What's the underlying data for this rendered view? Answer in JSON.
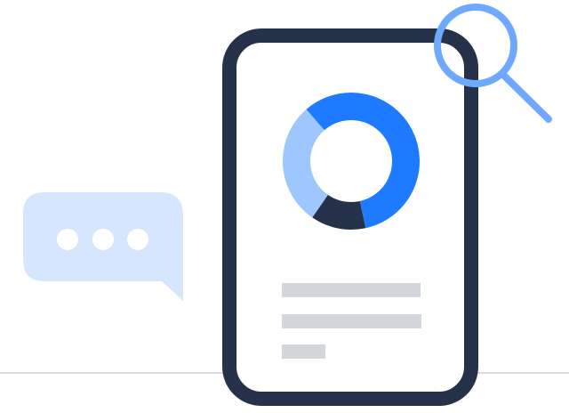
{
  "illustration": {
    "elements": {
      "chat_bubble": {
        "icon": "chat-bubble-typing-icon"
      },
      "document": {
        "icon": "mobile-document-icon"
      },
      "donut_chart": {
        "icon": "donut-chart-icon"
      },
      "text_lines": {
        "count": 3
      },
      "magnifier": {
        "icon": "magnifying-glass-icon"
      }
    },
    "donut_chart": {
      "segments": [
        {
          "color": "#1E7BFF",
          "value": 0.58
        },
        {
          "color": "#263249",
          "value": 0.13
        },
        {
          "color": "#9EC7FF",
          "value": 0.29
        }
      ]
    },
    "colors": {
      "frame": "#263249",
      "bubble": "#D6E6FF",
      "bubble_dots": "#FFFFFF",
      "text_lines": "#D3D6DB",
      "baseline": "#D9DCE1",
      "magnifier": "#6FA8FF"
    }
  }
}
